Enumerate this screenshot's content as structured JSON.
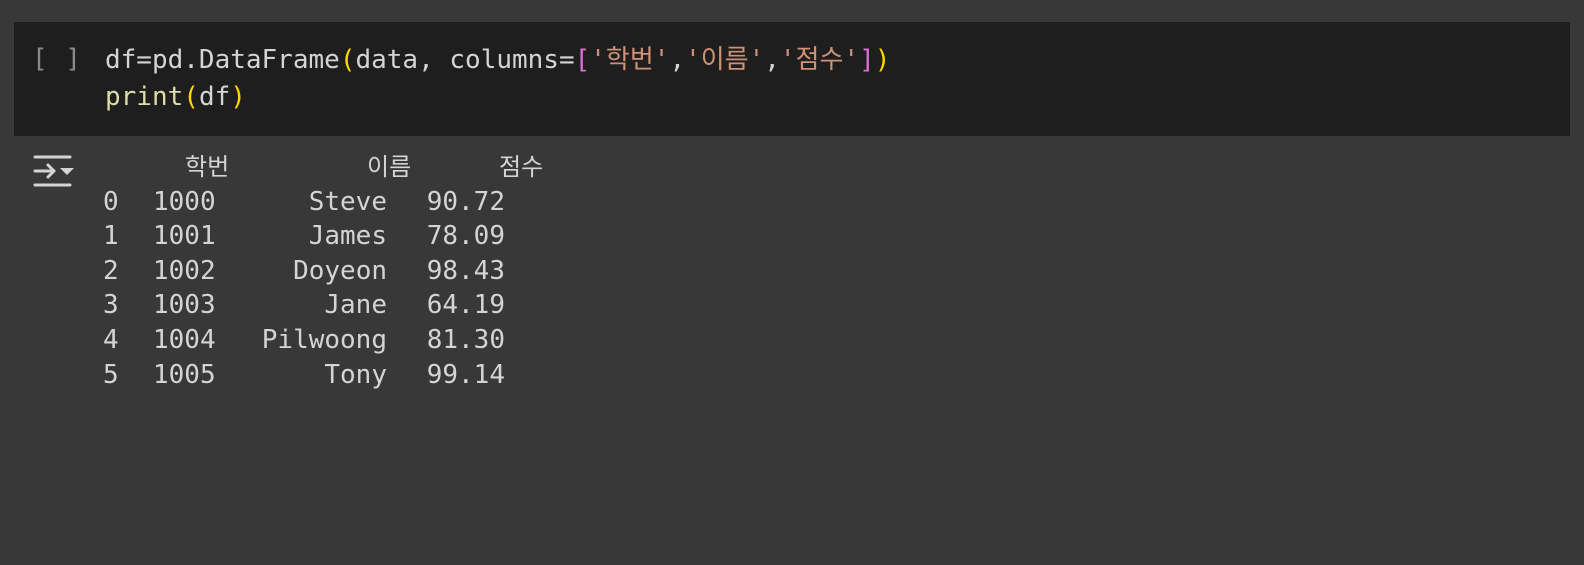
{
  "cell": {
    "run_indicator": "[ ]",
    "code": {
      "line1": {
        "t1": "df=pd.DataFrame",
        "t2": "(",
        "t3": "data, columns=",
        "t4": "[",
        "t5": "'학번'",
        "t6": ",",
        "t7": "'이름'",
        "t8": ",",
        "t9": "'점수'",
        "t10": "]",
        "t11": ")"
      },
      "line2": {
        "t1": "print",
        "t2": "(",
        "t3": "df",
        "t4": ")"
      }
    }
  },
  "output": {
    "icon": "output-toggle-icon",
    "headers": [
      "학번",
      "이름",
      "점수"
    ],
    "rows": [
      {
        "idx": "0",
        "id": "1000",
        "name": "Steve",
        "score": "90.72"
      },
      {
        "idx": "1",
        "id": "1001",
        "name": "James",
        "score": "78.09"
      },
      {
        "idx": "2",
        "id": "1002",
        "name": "Doyeon",
        "score": "98.43"
      },
      {
        "idx": "3",
        "id": "1003",
        "name": "Jane",
        "score": "64.19"
      },
      {
        "idx": "4",
        "id": "1004",
        "name": "Pilwoong",
        "score": "81.30"
      },
      {
        "idx": "5",
        "id": "1005",
        "name": "Tony",
        "score": "99.14"
      }
    ]
  },
  "colors": {
    "background": "#383838",
    "code_background": "#1e1e1e",
    "text": "#d4d4d4",
    "function": "#dcdcaa",
    "paren": "#ffd700",
    "bracket": "#da70d6",
    "string": "#ce9178"
  }
}
